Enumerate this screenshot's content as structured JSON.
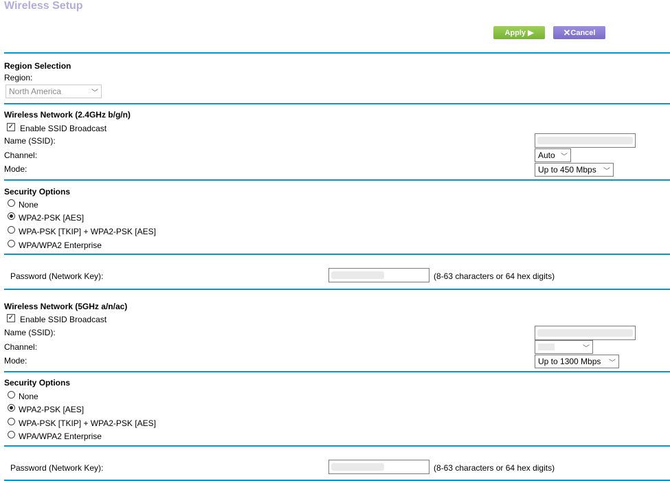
{
  "page": {
    "title": "Wireless Setup"
  },
  "toolbar": {
    "apply_label": "Apply",
    "cancel_label": "Cancel"
  },
  "region": {
    "heading": "Region Selection",
    "label": "Region:",
    "value": "North America"
  },
  "w24": {
    "heading": "Wireless Network (2.4GHz b/g/n)",
    "broadcast_label": "Enable SSID Broadcast",
    "broadcast_checked": true,
    "name_label": "Name (SSID):",
    "channel_label": "Channel:",
    "channel_value": "Auto",
    "mode_label": "Mode:",
    "mode_value": "Up to 450 Mbps",
    "security": {
      "heading": "Security Options",
      "options": [
        "None",
        "WPA2-PSK [AES]",
        "WPA-PSK [TKIP] + WPA2-PSK [AES]",
        "WPA/WPA2 Enterprise"
      ],
      "selected": 1
    },
    "password_label": "Password (Network Key):",
    "password_hint": "(8-63 characters or 64 hex digits)"
  },
  "w5": {
    "heading": "Wireless Network (5GHz a/n/ac)",
    "broadcast_label": "Enable SSID Broadcast",
    "broadcast_checked": true,
    "name_label": "Name (SSID):",
    "channel_label": "Channel:",
    "mode_label": "Mode:",
    "mode_value": "Up to 1300 Mbps",
    "security": {
      "heading": "Security Options",
      "options": [
        "None",
        "WPA2-PSK [AES]",
        "WPA-PSK [TKIP] + WPA2-PSK [AES]",
        "WPA/WPA2 Enterprise"
      ],
      "selected": 1
    },
    "password_label": "Password (Network Key):",
    "password_hint": "(8-63 characters or 64 hex digits)"
  },
  "colors": {
    "accent": "#0099cc",
    "apply": "#8cc34a",
    "cancel": "#8b7dd8",
    "title": "#b3acdb"
  }
}
